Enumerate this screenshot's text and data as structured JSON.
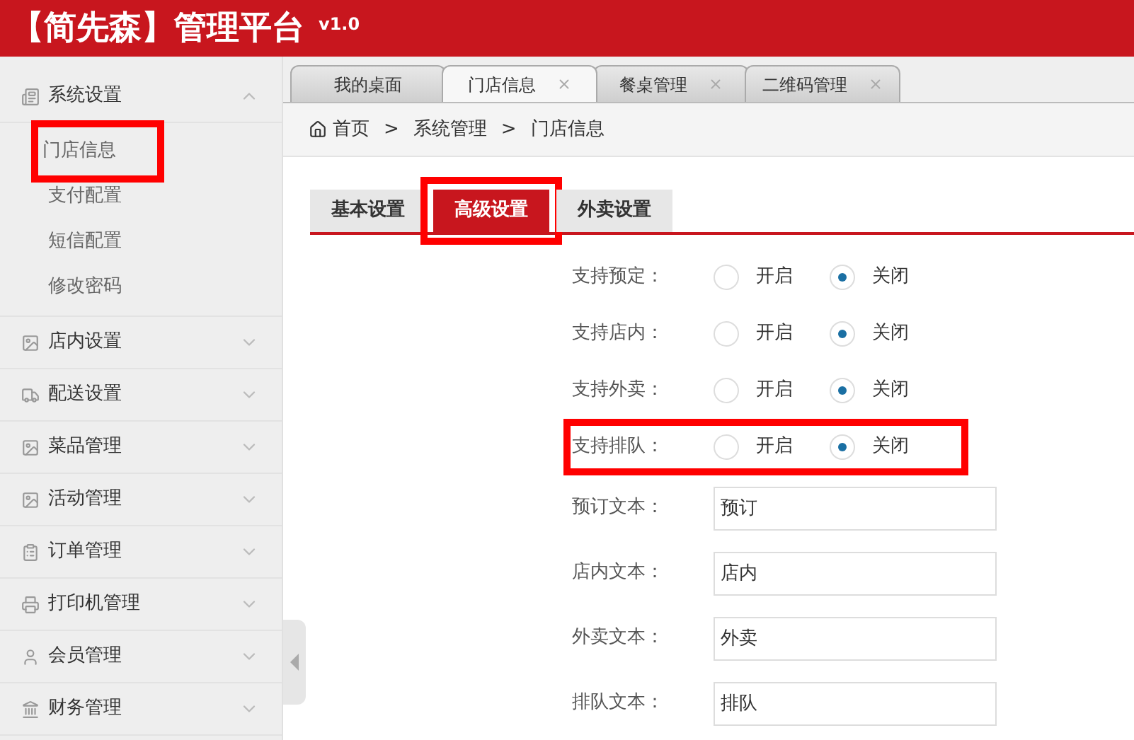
{
  "header": {
    "title": "【简先森】管理平台",
    "version": "v1.0"
  },
  "sidebar": {
    "sections": [
      {
        "label": "系统设置",
        "expanded": true,
        "children": [
          {
            "label": "门店信息",
            "highlighted": true
          },
          {
            "label": "支付配置",
            "highlighted": false
          },
          {
            "label": "短信配置",
            "highlighted": false
          },
          {
            "label": "修改密码",
            "highlighted": false
          }
        ]
      },
      {
        "label": "店内设置",
        "expanded": false
      },
      {
        "label": "配送设置",
        "expanded": false
      },
      {
        "label": "菜品管理",
        "expanded": false
      },
      {
        "label": "活动管理",
        "expanded": false
      },
      {
        "label": "订单管理",
        "expanded": false
      },
      {
        "label": "打印机管理",
        "expanded": false
      },
      {
        "label": "会员管理",
        "expanded": false
      },
      {
        "label": "财务管理",
        "expanded": false
      }
    ]
  },
  "page_tabs": [
    {
      "label": "我的桌面",
      "selected": false,
      "closable": false
    },
    {
      "label": "门店信息",
      "selected": true,
      "closable": true
    },
    {
      "label": "餐桌管理",
      "selected": false,
      "closable": true
    },
    {
      "label": "二维码管理",
      "selected": false,
      "closable": true
    }
  ],
  "breadcrumb": [
    "首页",
    "系统管理",
    "门店信息"
  ],
  "breadcrumb_separator": ">",
  "sub_tabs": [
    {
      "label": "基本设置",
      "selected": false,
      "highlighted": false
    },
    {
      "label": "高级设置",
      "selected": true,
      "highlighted": true
    },
    {
      "label": "外卖设置",
      "selected": false,
      "highlighted": false
    }
  ],
  "form": [
    {
      "kind": "radio",
      "label": "支持预定：",
      "highlighted": false,
      "options": [
        {
          "label": "开启",
          "selected": false
        },
        {
          "label": "关闭",
          "selected": true
        }
      ]
    },
    {
      "kind": "radio",
      "label": "支持店内：",
      "highlighted": false,
      "options": [
        {
          "label": "开启",
          "selected": false
        },
        {
          "label": "关闭",
          "selected": true
        }
      ]
    },
    {
      "kind": "radio",
      "label": "支持外卖：",
      "highlighted": false,
      "options": [
        {
          "label": "开启",
          "selected": false
        },
        {
          "label": "关闭",
          "selected": true
        }
      ]
    },
    {
      "kind": "radio",
      "label": "支持排队：",
      "highlighted": true,
      "options": [
        {
          "label": "开启",
          "selected": false
        },
        {
          "label": "关闭",
          "selected": true
        }
      ]
    },
    {
      "kind": "text",
      "label": "预订文本：",
      "value": "预订"
    },
    {
      "kind": "text",
      "label": "店内文本：",
      "value": "店内"
    },
    {
      "kind": "text",
      "label": "外卖文本：",
      "value": "外卖"
    },
    {
      "kind": "text",
      "label": "排队文本：",
      "value": "排队"
    }
  ]
}
